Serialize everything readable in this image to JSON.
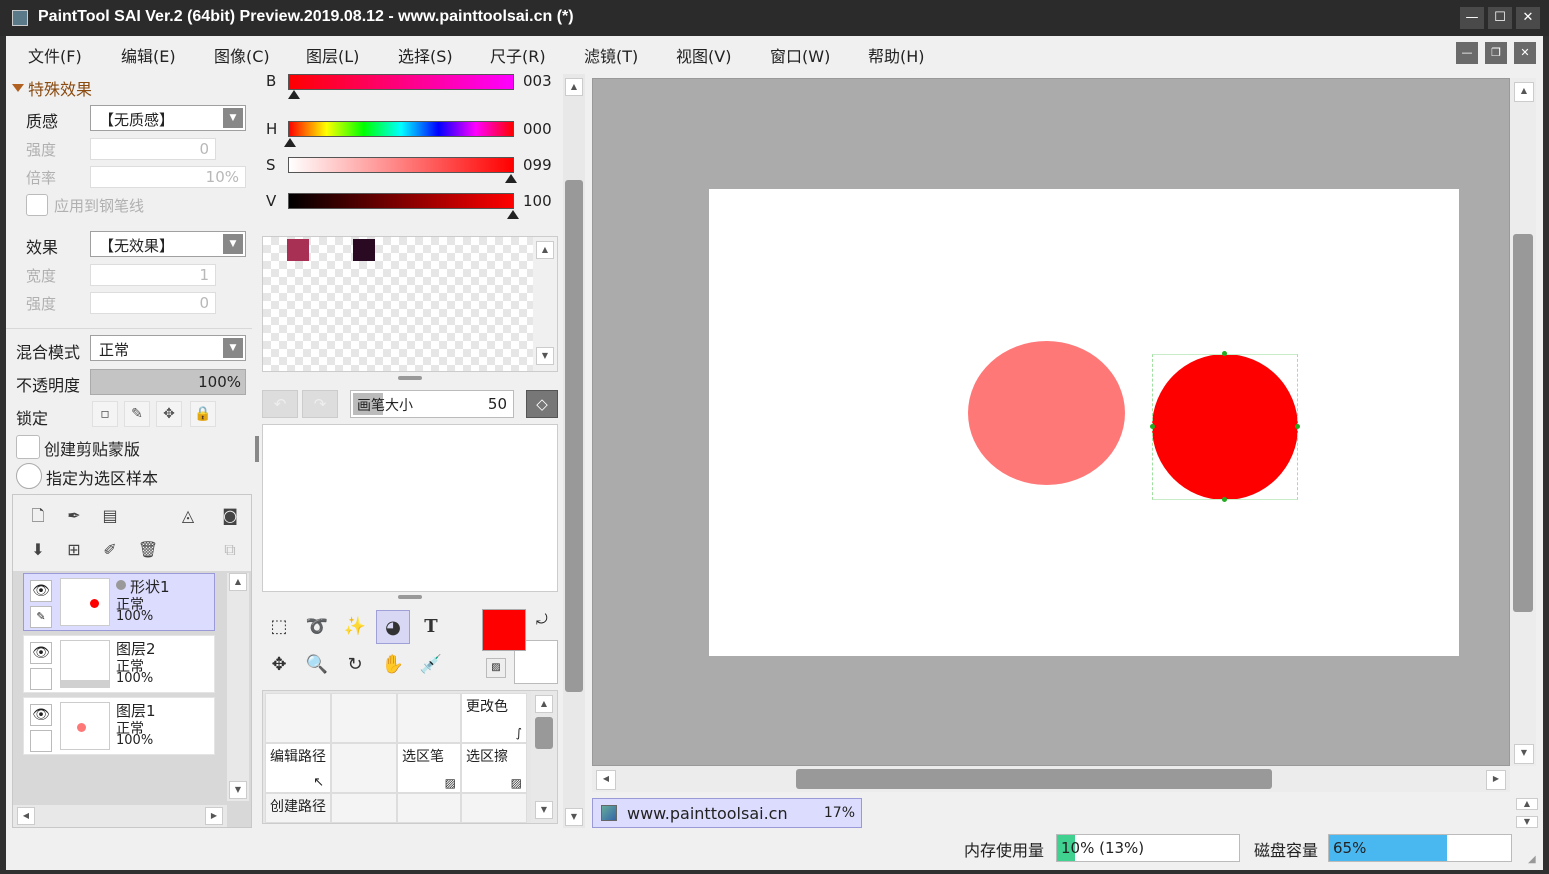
{
  "window": {
    "title": "PaintTool SAI Ver.2 (64bit) Preview.2019.08.12 - www.painttoolsai.cn (*)"
  },
  "menu": [
    {
      "label": "文件(F)"
    },
    {
      "label": "编辑(E)"
    },
    {
      "label": "图像(C)"
    },
    {
      "label": "图层(L)"
    },
    {
      "label": "选择(S)"
    },
    {
      "label": "尺子(R)"
    },
    {
      "label": "滤镜(T)"
    },
    {
      "label": "视图(V)"
    },
    {
      "label": "窗口(W)"
    },
    {
      "label": "帮助(H)"
    }
  ],
  "effects": {
    "section_title": "特殊效果",
    "texture_label": "质感",
    "texture_value": "【无质感】",
    "strength_label": "强度",
    "strength_value": "0",
    "scale_label": "倍率",
    "scale_value": "10%",
    "apply_pen_label": "应用到钢笔线",
    "effect_label": "效果",
    "effect_value": "【无效果】",
    "width_label": "宽度",
    "width_value": "1",
    "strength2_label": "强度",
    "strength2_value": "0"
  },
  "layer_props": {
    "blend_label": "混合模式",
    "blend_value": "正常",
    "opacity_label": "不透明度",
    "opacity_value": "100%",
    "lock_label": "锁定",
    "clip_label": "创建剪贴蒙版",
    "sel_sample_label": "指定为选区样本"
  },
  "layers": [
    {
      "name": "形状1",
      "mode": "正常",
      "opacity": "100%"
    },
    {
      "name": "图层2",
      "mode": "正常",
      "opacity": "100%"
    },
    {
      "name": "图层1",
      "mode": "正常",
      "opacity": "100%"
    }
  ],
  "color": {
    "b_label": "B",
    "b_value": "003",
    "h_label": "H",
    "h_value": "000",
    "s_label": "S",
    "s_value": "099",
    "v_label": "V",
    "v_value": "100",
    "swatches": [
      "#a83055",
      "#2a0a22"
    ],
    "primary": "#ff0000",
    "secondary": "#ffffff"
  },
  "brush": {
    "size_label": "画笔大小",
    "size_value": "50"
  },
  "tool_grid": {
    "change_color": "更改色",
    "edit_path": "编辑路径",
    "sel_pen": "选区笔",
    "sel_eraser": "选区擦",
    "create_path": "创建路径"
  },
  "canvas_tab": {
    "name": "www.painttoolsai.cn",
    "zoom": "17%"
  },
  "status": {
    "mem_label": "内存使用量",
    "mem_value": "10% (13%)",
    "mem_fill": 0.1,
    "disk_label": "磁盘容量",
    "disk_value": "65%",
    "disk_fill": 0.65
  },
  "colors": {
    "accent": "#4ab8f0",
    "shape_light": "#ff7878",
    "shape_red": "#ff0000"
  }
}
